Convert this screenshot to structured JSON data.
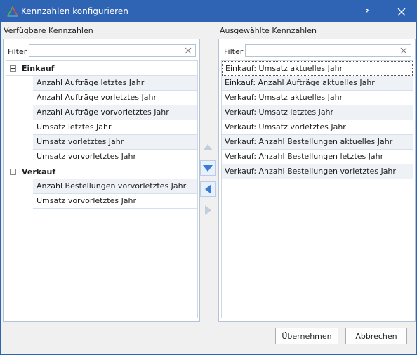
{
  "window": {
    "title": "Kennzahlen konfigurieren"
  },
  "left": {
    "heading": "Verfügbare Kennzahlen",
    "filter_label": "Filter",
    "filter_value": "",
    "groups": [
      {
        "name": "Einkauf",
        "items": [
          "Anzahl Aufträge letztes Jahr",
          "Anzahl Aufträge vorletztes Jahr",
          "Anzahl Aufträge vorvorletztes Jahr",
          "Umsatz letztes Jahr",
          "Umsatz vorletztes Jahr",
          "Umsatz vorvorletztes Jahr"
        ]
      },
      {
        "name": "Verkauf",
        "items": [
          "Anzahl Bestellungen vorvorletztes Jahr",
          "Umsatz vorvorletztes Jahr"
        ]
      }
    ]
  },
  "right": {
    "heading": "Ausgewählte Kennzahlen",
    "filter_label": "Filter",
    "filter_value": "",
    "items": [
      "Einkauf: Umsatz aktuelles Jahr",
      "Einkauf: Anzahl Aufträge aktuelles Jahr",
      "Verkauf: Umsatz aktuelles Jahr",
      "Verkauf: Umsatz letztes Jahr",
      "Verkauf: Umsatz vorletztes Jahr",
      "Verkauf: Anzahl Bestellungen aktuelles Jahr",
      "Verkauf: Anzahl Bestellungen letztes Jahr",
      "Verkauf: Anzahl Bestellungen vorletztes Jahr"
    ]
  },
  "buttons": {
    "apply": "Übernehmen",
    "cancel": "Abbrechen"
  },
  "icons": {
    "app": "chart-triangle-icon",
    "help": "help-icon",
    "close": "close-icon",
    "clear": "clear-filter-icon",
    "move_up": "arrow-up-icon",
    "move_down": "arrow-down-icon",
    "move_left": "arrow-left-icon",
    "move_right": "arrow-right-icon"
  },
  "colors": {
    "titlebar": "#2f64b4",
    "accent": "#3a7bd5"
  }
}
